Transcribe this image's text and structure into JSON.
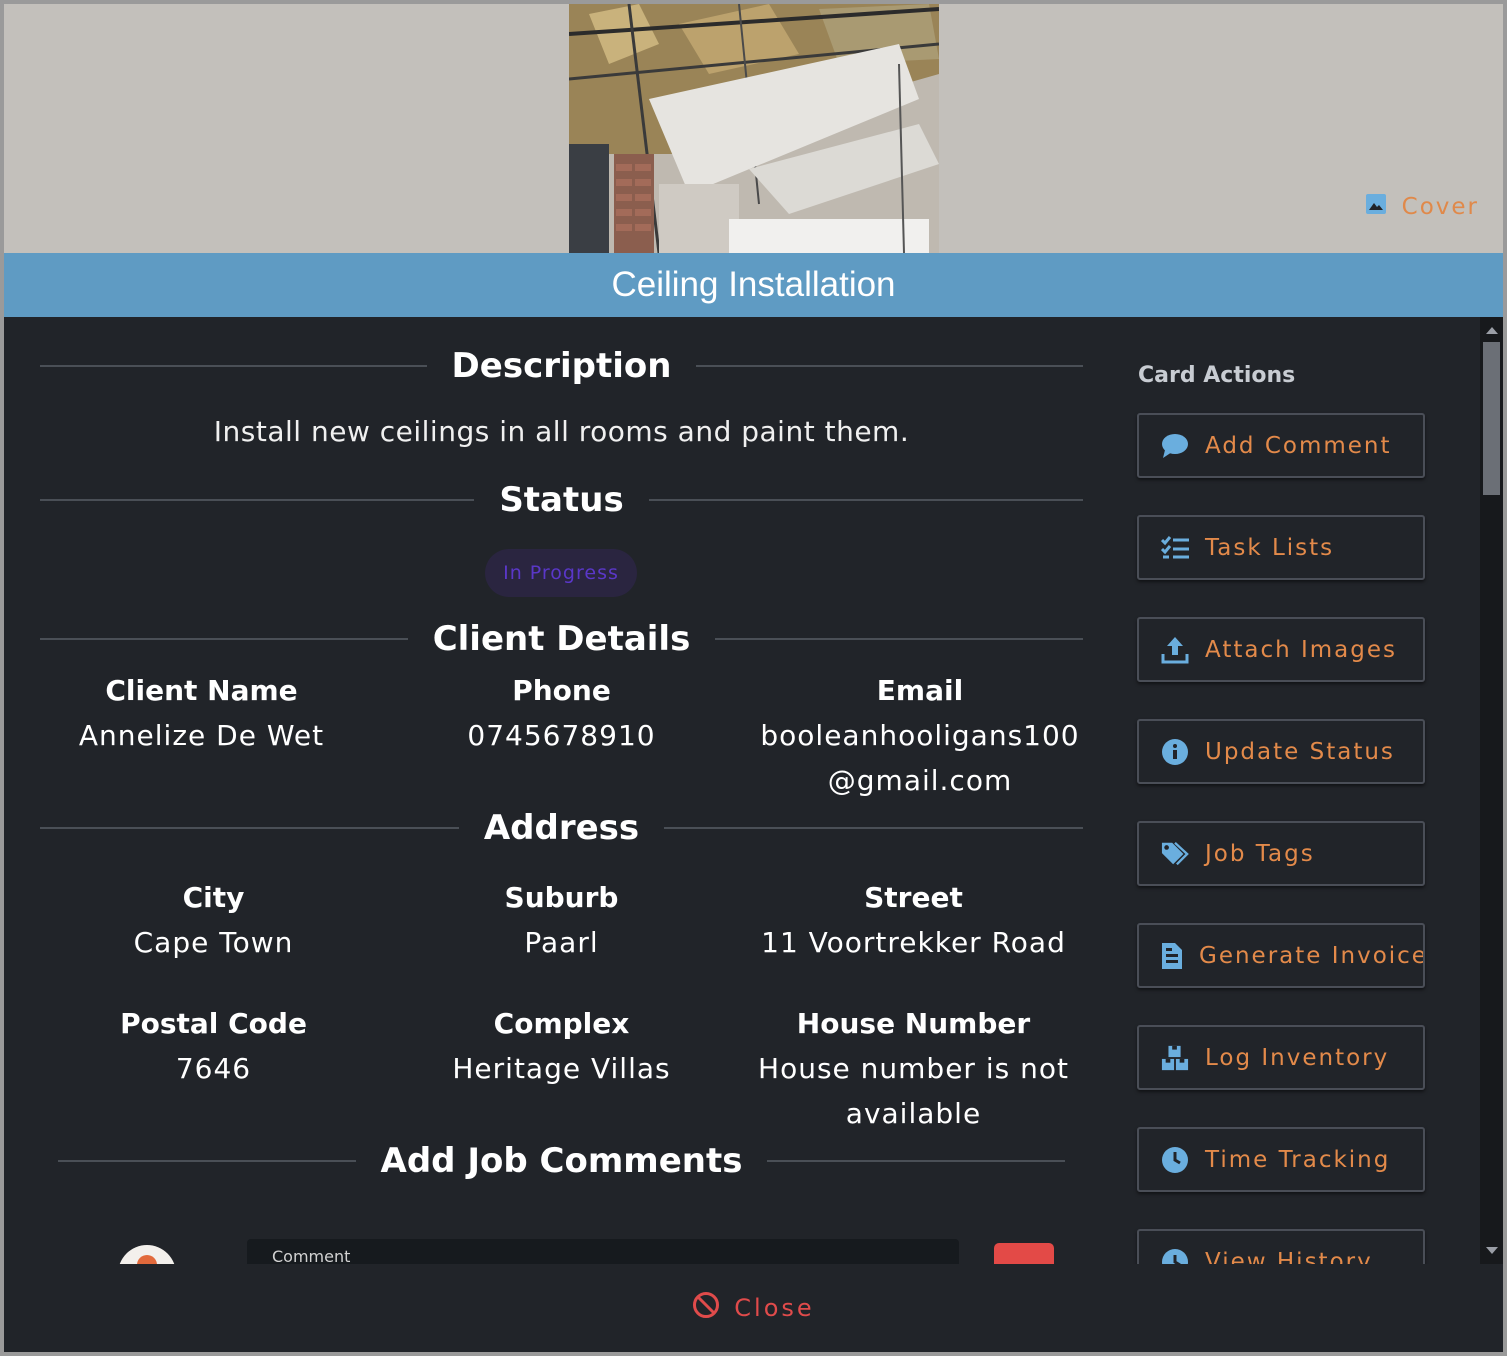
{
  "cover": {
    "button_label": "Cover",
    "photo_icon": "image-icon"
  },
  "title": "Ceiling Installation",
  "sections": {
    "description": "Description",
    "status": "Status",
    "client": "Client Details",
    "address": "Address",
    "comments": "Add Job Comments"
  },
  "description_text": "Install new ceilings in all rooms and paint them.",
  "status_badge": "In Progress",
  "client": {
    "name_label": "Client Name",
    "name_value": "Annelize De Wet",
    "phone_label": "Phone",
    "phone_value": "0745678910",
    "email_label": "Email",
    "email_value_line1": "booleanhooligans100",
    "email_value_line2": "@gmail.com"
  },
  "address": {
    "city_label": "City",
    "city_value": "Cape Town",
    "suburb_label": "Suburb",
    "suburb_value": "Paarl",
    "street_label": "Street",
    "street_value": "11 Voortrekker Road",
    "postal_label": "Postal Code",
    "postal_value": "7646",
    "complex_label": "Complex",
    "complex_value": "Heritage Villas",
    "house_label": "House Number",
    "house_value_line1": "House number is not",
    "house_value_line2": "available"
  },
  "comment_input": {
    "label": "Comment"
  },
  "card_actions": {
    "title": "Card Actions",
    "items": [
      {
        "label": "Add Comment",
        "icon": "comment-icon"
      },
      {
        "label": "Task Lists",
        "icon": "checklist-icon"
      },
      {
        "label": "Attach Images",
        "icon": "upload-icon"
      },
      {
        "label": "Update Status",
        "icon": "info-icon"
      },
      {
        "label": "Job Tags",
        "icon": "tags-icon"
      },
      {
        "label": "Generate Invoice",
        "icon": "invoice-icon"
      },
      {
        "label": "Log Inventory",
        "icon": "inventory-icon"
      },
      {
        "label": "Time Tracking",
        "icon": "clock-icon"
      },
      {
        "label": "View History",
        "icon": "history-icon"
      }
    ]
  },
  "footer": {
    "close_label": "Close",
    "close_icon": "ban-icon"
  },
  "colors": {
    "accent": "#e38a4a",
    "title_bar": "#5f9bc3",
    "background": "#212429",
    "status_text": "#5a37c8",
    "close": "#e04b4b",
    "icon_blue": "#6aaede"
  }
}
